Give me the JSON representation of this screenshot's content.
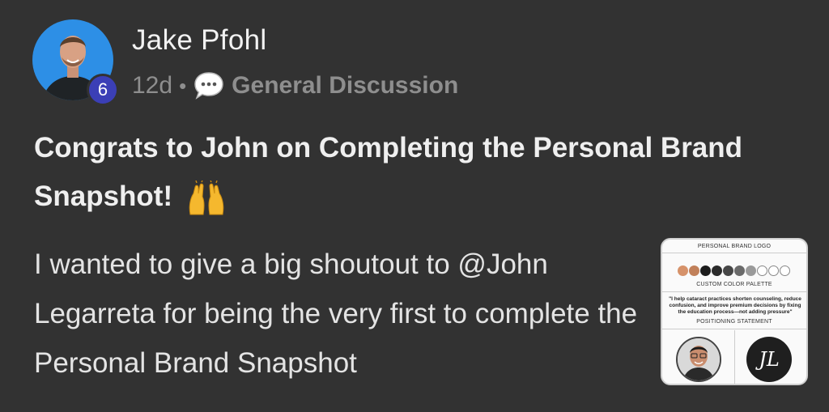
{
  "author": {
    "name": "Jake Pfohl",
    "level": "6"
  },
  "meta": {
    "age": "12d",
    "separator": "•",
    "category": "General Discussion",
    "category_icon": "speech-bubble-icon"
  },
  "post": {
    "title": "Congrats to John on Completing the Personal Brand Snapshot!",
    "title_emoji": "raising-hands-icon",
    "body": "I wanted to give a big shoutout to @John Legarreta for being the very first to complete the Personal Brand Snapshot"
  },
  "attachment": {
    "logo_label": "PERSONAL BRAND LOGO",
    "palette_label": "CUSTOM COLOR PALETTE",
    "quote": "\"I help cataract practices shorten counseling, reduce confusion, and improve premium decisions by fixing the education process—not adding pressure\"",
    "positioning_label": "POSITIONING STATEMENT",
    "monogram": "JL",
    "palette": [
      "#d6926a",
      "#c1805a",
      "#1c1c1c",
      "#2b2b2b",
      "#474747",
      "#6a6a6a",
      "#9a9a9a",
      "#ffffff",
      "#ffffff",
      "#ffffff"
    ]
  },
  "colors": {
    "background": "#323232",
    "avatar_bg": "#2d8fe6",
    "level_badge": "#3b3fb6",
    "meta_text": "#8e8e8e"
  }
}
